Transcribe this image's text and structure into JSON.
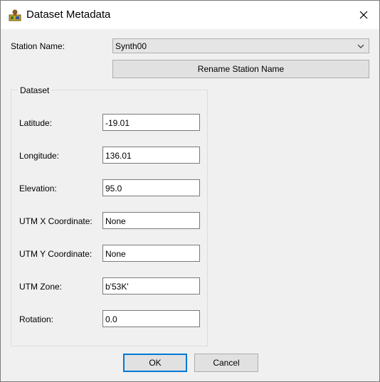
{
  "window": {
    "title": "Dataset Metadata",
    "app_icon": "app-icon",
    "close_icon": "close-icon"
  },
  "station": {
    "label": "Station Name:",
    "selected": "Synth00",
    "rename_label": "Rename Station Name"
  },
  "dataset": {
    "group_title": "Dataset",
    "fields": [
      {
        "label": "Latitude:",
        "value": "-19.01"
      },
      {
        "label": "Longitude:",
        "value": "136.01"
      },
      {
        "label": "Elevation:",
        "value": "95.0"
      },
      {
        "label": "UTM X Coordinate:",
        "value": "None"
      },
      {
        "label": "UTM Y Coordinate:",
        "value": "None"
      },
      {
        "label": "UTM Zone:",
        "value": "b'53K'"
      },
      {
        "label": "Rotation:",
        "value": "0.0"
      }
    ]
  },
  "buttons": {
    "ok": "OK",
    "cancel": "Cancel"
  },
  "colors": {
    "focus_border": "#0078d7",
    "background": "#f0f0f0"
  }
}
